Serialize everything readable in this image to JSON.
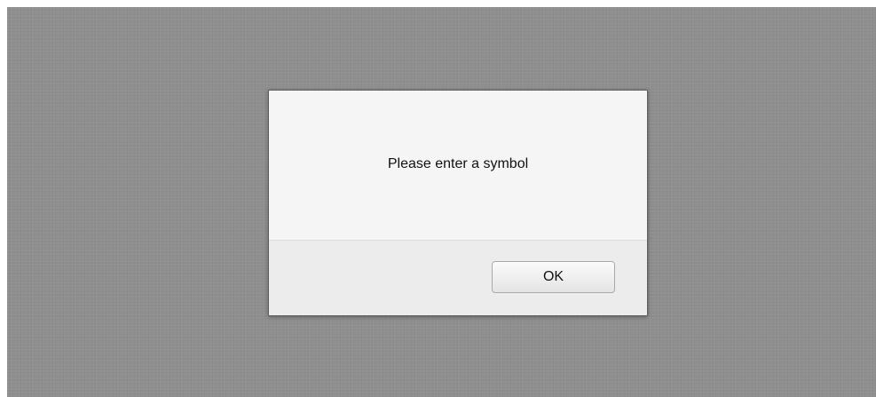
{
  "dialog": {
    "message": "Please enter a symbol",
    "ok_label": "OK"
  }
}
